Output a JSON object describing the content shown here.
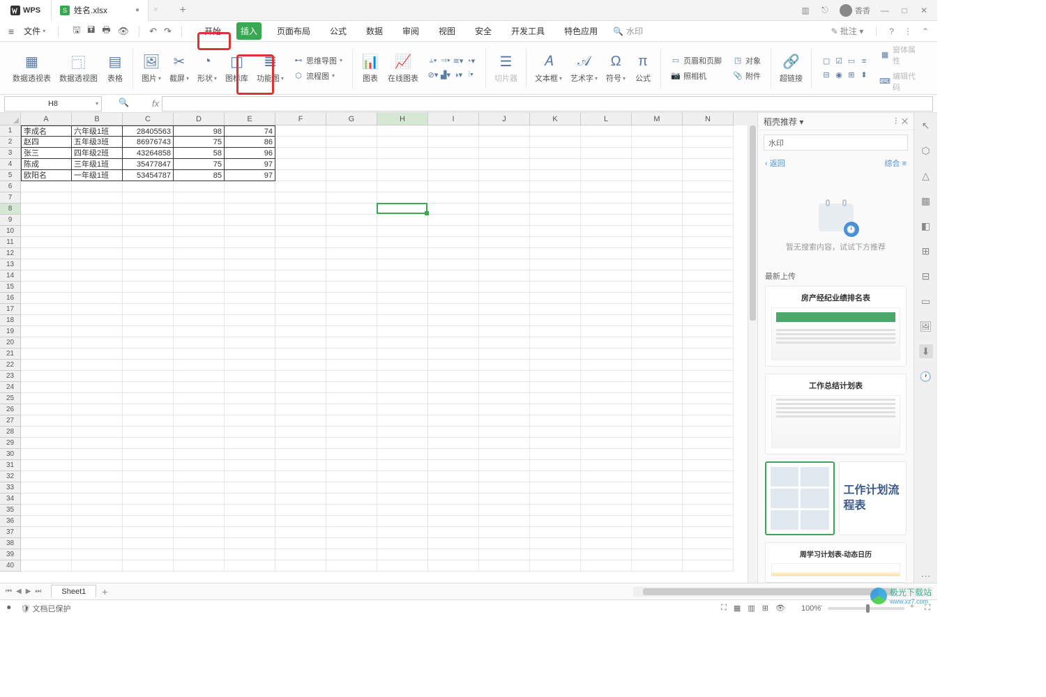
{
  "app": {
    "name": "WPS"
  },
  "doc": {
    "filename": "姓名.xlsx"
  },
  "user": {
    "name": "香香"
  },
  "menu": {
    "file": "文件",
    "tabs": [
      "开始",
      "插入",
      "页面布局",
      "公式",
      "数据",
      "审阅",
      "视图",
      "安全",
      "开发工具",
      "特色应用"
    ],
    "active_index": 1,
    "search_placeholder": "水印",
    "annotate": "批注"
  },
  "ribbon": {
    "pivot_table": "数据透视表",
    "pivot_chart": "数据透视图",
    "table": "表格",
    "picture": "图片",
    "screenshot": "截屏",
    "shapes": "形状",
    "icon_lib": "图标库",
    "function_chart": "功能图",
    "mindmap": "思维导图",
    "flowchart": "流程图",
    "chart": "图表",
    "online_chart": "在线图表",
    "slicer": "切片器",
    "textbox": "文本框",
    "wordart": "艺术字",
    "symbol": "符号",
    "formula": "公式",
    "header_footer": "页眉和页脚",
    "object": "对象",
    "camera": "照相机",
    "attachment": "附件",
    "hyperlink": "超链接",
    "form_props": "窗体属性",
    "edit_code": "编辑代码"
  },
  "cell_ref": "H8",
  "columns": [
    "A",
    "B",
    "C",
    "D",
    "E",
    "F",
    "G",
    "H",
    "I",
    "J",
    "K",
    "L",
    "M",
    "N"
  ],
  "active_col": "H",
  "active_row": 8,
  "data_rows": [
    {
      "a": "李成名",
      "b": "六年级1班",
      "c": "28405563",
      "d": "98",
      "e": "74"
    },
    {
      "a": "赵四",
      "b": "五年级3班",
      "c": "86976743",
      "d": "75",
      "e": "86"
    },
    {
      "a": "张三",
      "b": "四年级2班",
      "c": "43264858",
      "d": "58",
      "e": "96"
    },
    {
      "a": "陈成",
      "b": "三年级1班",
      "c": "35477847",
      "d": "75",
      "e": "97"
    },
    {
      "a": "欧阳名",
      "b": "一年级1班",
      "c": "53454787",
      "d": "85",
      "e": "97"
    }
  ],
  "visible_rows": 40,
  "panel": {
    "title": "稻壳推荐",
    "search_value": "水印",
    "back": "返回",
    "filter": "综合",
    "empty_text": "暂无搜索内容，试试下方推荐",
    "section": "最新上传",
    "templates": [
      "房产经纪业绩排名表",
      "工作总结计划表",
      "工作计划流程表",
      "周学习计划表-动态日历"
    ]
  },
  "sheet": {
    "name": "Sheet1"
  },
  "status": {
    "protected": "文档已保护",
    "zoom": "100%"
  },
  "watermark": {
    "site": "极光下载站",
    "url": "www.xz7.com"
  }
}
